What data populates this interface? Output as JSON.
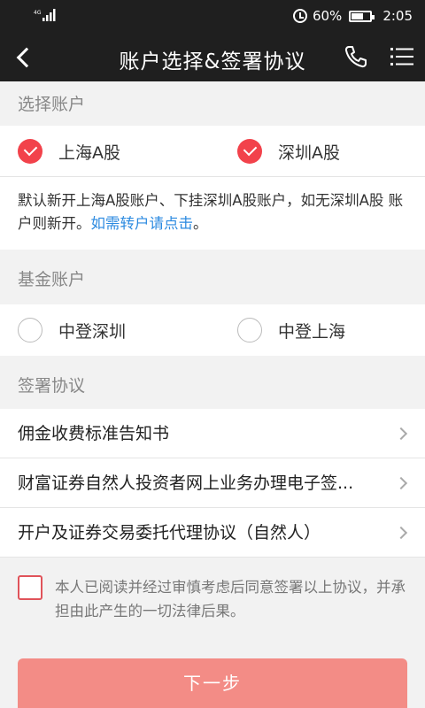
{
  "status": {
    "network": "4G",
    "battery": "60%",
    "time": "2:05"
  },
  "nav": {
    "title": "账户选择&签署协议"
  },
  "sections": {
    "select_account": "选择账户",
    "fund_account": "基金账户",
    "agreements": "签署协议"
  },
  "select_account": {
    "options": [
      {
        "label": "上海A股",
        "checked": true
      },
      {
        "label": "深圳A股",
        "checked": true
      }
    ],
    "notice": "默认新开上海A股账户、下挂深圳A股账户，如无深圳A股 账户则新开。",
    "notice_link": "如需转户请点击",
    "notice_end": "。"
  },
  "fund_account": {
    "options": [
      {
        "label": "中登深圳",
        "checked": false
      },
      {
        "label": "中登上海",
        "checked": false
      }
    ]
  },
  "agreement_items": [
    "佣金收费标准告知书",
    "财富证券自然人投资者网上业务办理电子签...",
    "开户及证券交易委托代理协议（自然人）"
  ],
  "consent": {
    "text": "本人已阅读并经过审慎考虑后同意签署以上协议，并承担由此产生的一切法律后果。",
    "checked": false
  },
  "next_button": "下一步",
  "colors": {
    "accent_red": "#f2424b",
    "button": "#f38c86",
    "link": "#2b8ae0",
    "header": "#1f1f1f"
  }
}
